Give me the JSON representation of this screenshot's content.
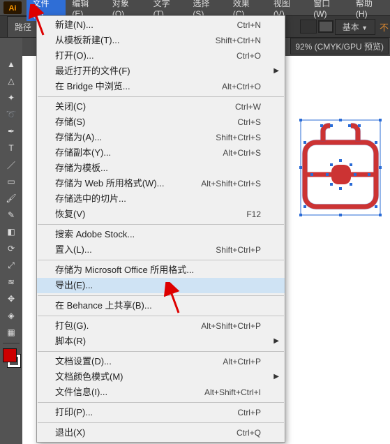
{
  "menubar": {
    "items": [
      {
        "label": "文件(F)",
        "open": true
      },
      {
        "label": "编辑(E)"
      },
      {
        "label": "对象(O)"
      },
      {
        "label": "文字(T)"
      },
      {
        "label": "选择(S)"
      },
      {
        "label": "效果(C)"
      },
      {
        "label": "视图(V)"
      },
      {
        "label": "窗口(W)"
      },
      {
        "label": "帮助(H)"
      }
    ]
  },
  "tabrow": {
    "tab_label": "路径",
    "basic_label": "基本",
    "orange_text": "不",
    "status_text": "92% (CMYK/GPU 预览)"
  },
  "dropdown": [
    {
      "type": "item",
      "label": "新建(N)...",
      "shortcut": "Ctrl+N"
    },
    {
      "type": "item",
      "label": "从模板新建(T)...",
      "shortcut": "Shift+Ctrl+N"
    },
    {
      "type": "item",
      "label": "打开(O)...",
      "shortcut": "Ctrl+O"
    },
    {
      "type": "item",
      "label": "最近打开的文件(F)",
      "submenu": true
    },
    {
      "type": "item",
      "label": "在 Bridge 中浏览...",
      "shortcut": "Alt+Ctrl+O"
    },
    {
      "type": "sep"
    },
    {
      "type": "item",
      "label": "关闭(C)",
      "shortcut": "Ctrl+W"
    },
    {
      "type": "item",
      "label": "存储(S)",
      "shortcut": "Ctrl+S"
    },
    {
      "type": "item",
      "label": "存储为(A)...",
      "shortcut": "Shift+Ctrl+S"
    },
    {
      "type": "item",
      "label": "存储副本(Y)...",
      "shortcut": "Alt+Ctrl+S"
    },
    {
      "type": "item",
      "label": "存储为模板..."
    },
    {
      "type": "item",
      "label": "存储为 Web 所用格式(W)...",
      "shortcut": "Alt+Shift+Ctrl+S"
    },
    {
      "type": "item",
      "label": "存储选中的切片..."
    },
    {
      "type": "item",
      "label": "恢复(V)",
      "shortcut": "F12"
    },
    {
      "type": "sep"
    },
    {
      "type": "item",
      "label": "搜索 Adobe Stock..."
    },
    {
      "type": "item",
      "label": "置入(L)...",
      "shortcut": "Shift+Ctrl+P"
    },
    {
      "type": "sep"
    },
    {
      "type": "item",
      "label": "存储为 Microsoft Office 所用格式..."
    },
    {
      "type": "item",
      "label": "导出(E)...",
      "highlighted": true
    },
    {
      "type": "sep"
    },
    {
      "type": "item",
      "label": "在 Behance 上共享(B)..."
    },
    {
      "type": "sep"
    },
    {
      "type": "item",
      "label": "打包(G).",
      "shortcut": "Alt+Shift+Ctrl+P"
    },
    {
      "type": "item",
      "label": "脚本(R)",
      "submenu": true
    },
    {
      "type": "sep"
    },
    {
      "type": "item",
      "label": "文档设置(D)...",
      "shortcut": "Alt+Ctrl+P"
    },
    {
      "type": "item",
      "label": "文档颜色模式(M)",
      "submenu": true
    },
    {
      "type": "item",
      "label": "文件信息(I)...",
      "shortcut": "Alt+Shift+Ctrl+I"
    },
    {
      "type": "sep"
    },
    {
      "type": "item",
      "label": "打印(P)...",
      "shortcut": "Ctrl+P"
    },
    {
      "type": "sep"
    },
    {
      "type": "item",
      "label": "退出(X)",
      "shortcut": "Ctrl+Q"
    }
  ],
  "tool_icons": [
    "selection",
    "direct-selection",
    "magic-wand",
    "lasso",
    "pen",
    "type",
    "line",
    "rectangle",
    "paintbrush",
    "pencil",
    "eraser",
    "rotate",
    "scale",
    "width",
    "free-transform",
    "shape-builder",
    "perspective",
    "mesh",
    "gradient",
    "eyedropper",
    "blend",
    "symbol-sprayer",
    "column-graph",
    "artboard",
    "slice",
    "hand",
    "zoom"
  ]
}
